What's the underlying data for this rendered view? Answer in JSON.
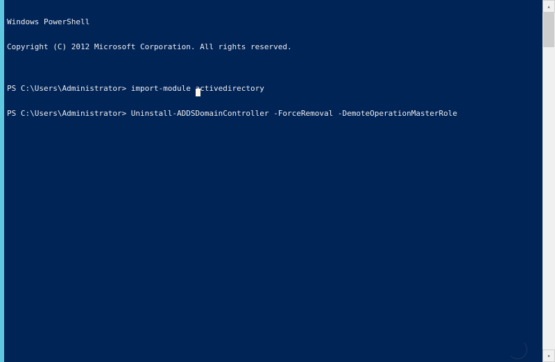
{
  "console": {
    "lines": [
      "Windows PowerShell",
      "Copyright (C) 2012 Microsoft Corporation. All rights reserved.",
      "",
      "PS C:\\Users\\Administrator> import-module activedirectory",
      "PS C:\\Users\\Administrator> Uninstall-ADDSDomainController -ForceRemoval -DemoteOperationMasterRole"
    ]
  },
  "scrollbar": {
    "up_glyph": "▴",
    "down_glyph": "▾"
  }
}
